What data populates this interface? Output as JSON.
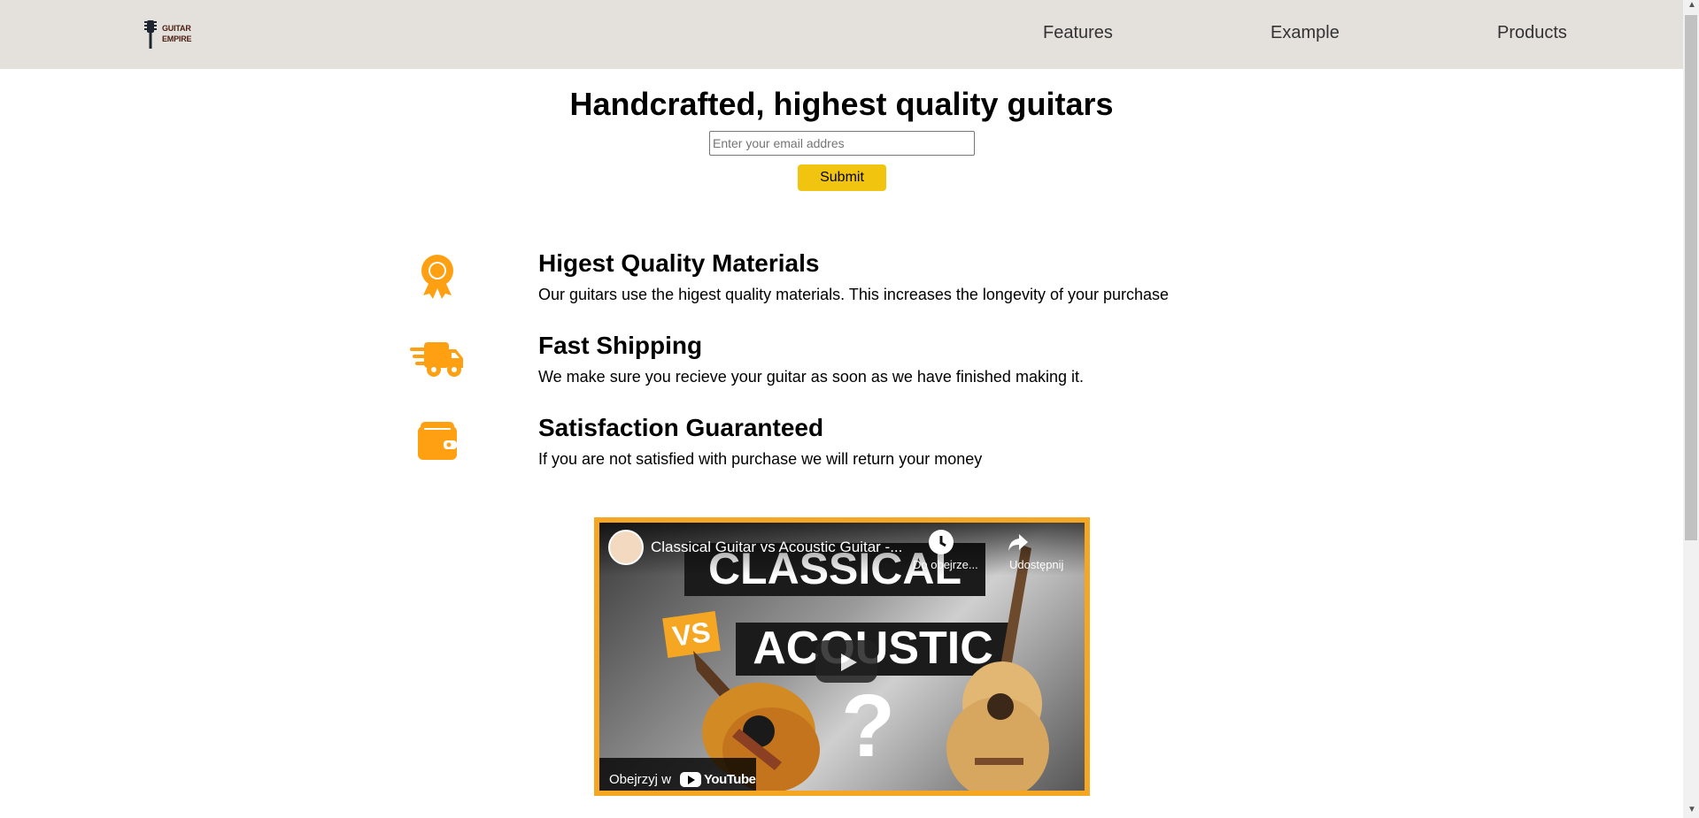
{
  "header": {
    "logo_line1": "GUITAR",
    "logo_line2": "EMPIRE",
    "nav": [
      "Features",
      "Example",
      "Products"
    ]
  },
  "hero": {
    "title": "Handcrafted, highest quality guitars",
    "email_placeholder": "Enter your email addres",
    "submit_label": "Submit"
  },
  "features": [
    {
      "icon": "award-icon",
      "title": "Higest Quality Materials",
      "description": "Our guitars use the higest quality materials. This increases the longevity of your purchase"
    },
    {
      "icon": "truck-icon",
      "title": "Fast Shipping",
      "description": "We make sure you recieve your guitar as soon as we have finished making it."
    },
    {
      "icon": "wallet-icon",
      "title": "Satisfaction Guaranteed",
      "description": "If you are not satisfied with purchase we will return your money"
    }
  ],
  "video": {
    "title": "Classical Guitar vs Acoustic Guitar -...",
    "watch_later": "Do obejrze...",
    "share": "Udostępnij",
    "poster_top": "CLASSICAL",
    "poster_vs": "VS",
    "poster_bottom": "ACOUSTIC",
    "poster_question": "?",
    "watch_on": "Obejrzyj w",
    "youtube": "YouTube"
  },
  "colors": {
    "header": "#e4e1dd",
    "accent": "#f5a623",
    "submit": "#f1c40f"
  }
}
